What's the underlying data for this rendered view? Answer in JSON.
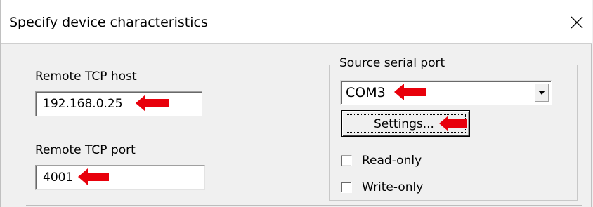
{
  "window": {
    "title": "Specify device characteristics"
  },
  "remote_host": {
    "label": "Remote TCP host",
    "value": "192.168.0.25"
  },
  "remote_port": {
    "label": "Remote TCP port",
    "value": "4001"
  },
  "source_serial": {
    "legend": "Source serial port",
    "selected_port": "COM3",
    "settings_label": "Settings...",
    "read_only_label": "Read-only",
    "read_only_checked": false,
    "write_only_label": "Write-only",
    "write_only_checked": false
  },
  "colors": {
    "annotation_arrow": "#e8000b",
    "window_background": "#f0f0f0",
    "title_background": "#ffffff"
  },
  "icons": {
    "close": "close-icon",
    "dropdown": "chevron-down-icon",
    "annotation": "red-arrow-icon"
  }
}
